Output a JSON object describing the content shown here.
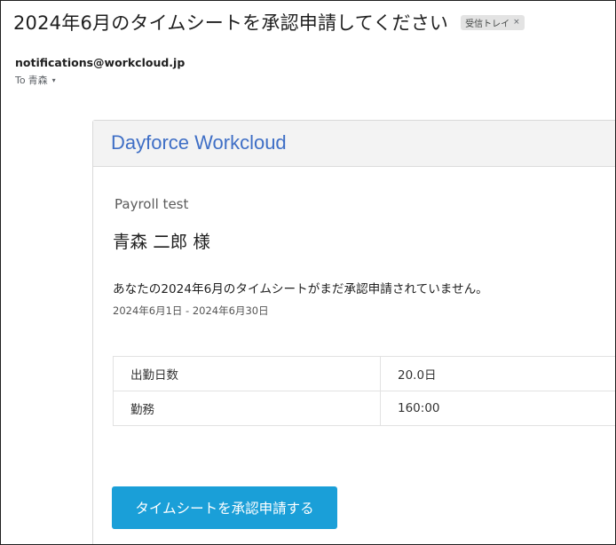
{
  "email": {
    "subject": "2024年6月のタイムシートを承認申請してください",
    "label": "受信トレイ",
    "label_close": "×",
    "sender": "notifications@workcloud.jp",
    "recipient_prefix": "To",
    "recipient": "青森",
    "recipient_caret": "▾"
  },
  "card": {
    "brand": "Dayforce Workcloud",
    "company": "Payroll test",
    "greeting": "青森 二郎 様",
    "message": "あなたの2024年6月のタイムシートがまだ承認申請されていません。",
    "period": "2024年6月1日 - 2024年6月30日",
    "stats": [
      {
        "label": "出勤日数",
        "value": "20.0日"
      },
      {
        "label": "勤務",
        "value": "160:00"
      }
    ],
    "button_label": "タイムシートを承認申請する"
  }
}
